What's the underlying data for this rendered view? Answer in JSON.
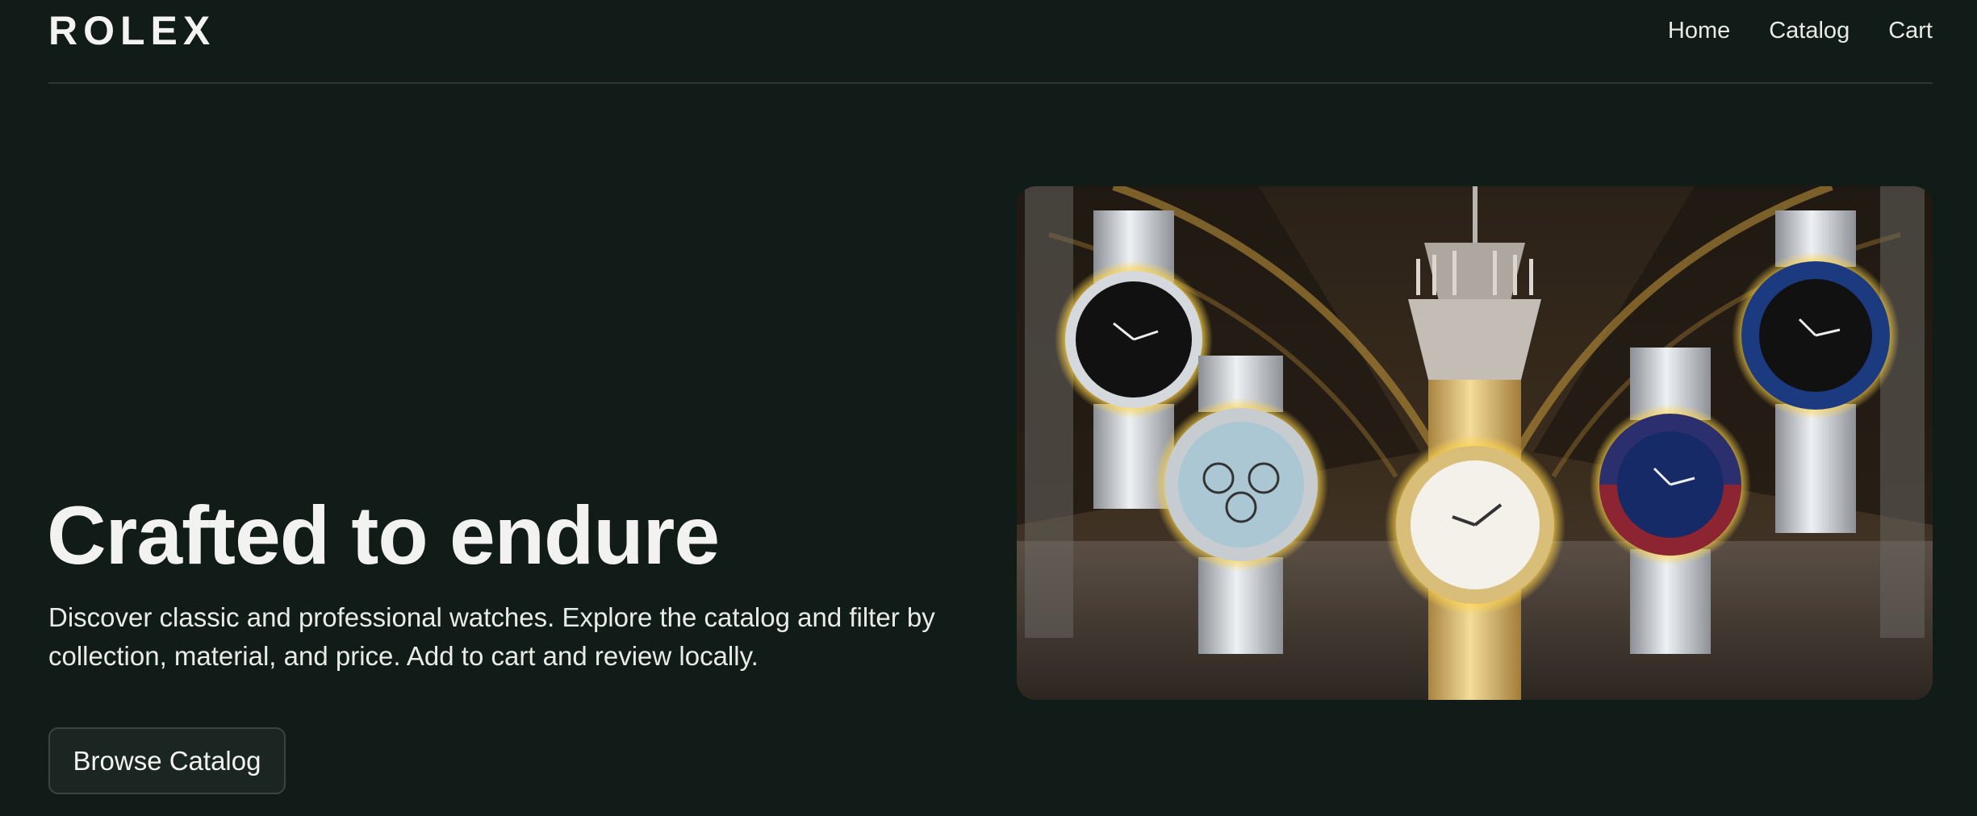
{
  "brand": {
    "logo": "ROLEX"
  },
  "nav": {
    "items": [
      {
        "label": "Home"
      },
      {
        "label": "Catalog"
      },
      {
        "label": "Cart"
      }
    ]
  },
  "hero": {
    "title": "Crafted to endure",
    "description": "Discover classic and professional watches. Explore the catalog and filter by collection, material, and price. Add to cart and review locally.",
    "cta_label": "Browse Catalog",
    "image_subject": "five Rolex watches in a gilded mirrored hall with chandelier"
  },
  "colors": {
    "background": "#111c18",
    "text": "#f2f3f0",
    "divider": "#2e3733",
    "button_bg": "#1b2521",
    "button_border": "#3a4541"
  }
}
